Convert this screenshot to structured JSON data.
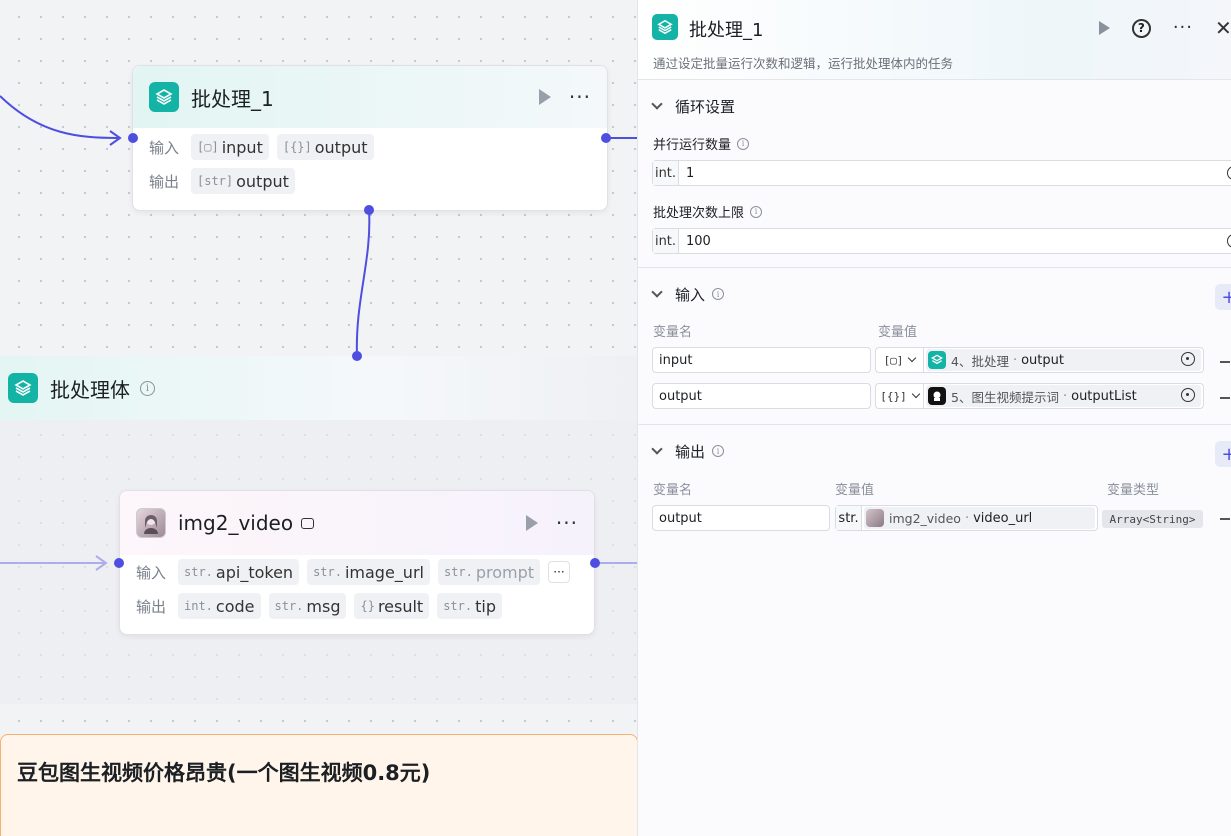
{
  "canvas": {
    "batch_node": {
      "title": "批处理_1",
      "input_label": "输入",
      "output_label": "输出",
      "inputs": [
        {
          "type": "[▢]",
          "name": "input"
        },
        {
          "type": "[{}]",
          "name": "output"
        }
      ],
      "outputs": [
        {
          "type": "[str]",
          "name": "output"
        }
      ]
    },
    "group": {
      "title": "批处理体"
    },
    "video_node": {
      "title": "img2_video",
      "input_label": "输入",
      "output_label": "输出",
      "inputs": [
        {
          "type": "str.",
          "name": "api_token"
        },
        {
          "type": "str.",
          "name": "image_url"
        },
        {
          "type": "str.",
          "name": "prompt"
        }
      ],
      "more": "···",
      "outputs": [
        {
          "type": "int.",
          "name": "code"
        },
        {
          "type": "str.",
          "name": "msg"
        },
        {
          "type": "{}",
          "name": "result"
        },
        {
          "type": "str.",
          "name": "tip"
        }
      ]
    },
    "note": {
      "text": "豆包图生视频价格昂贵(一个图生视频0.8元)"
    }
  },
  "panel": {
    "title": "批处理_1",
    "description": "通过设定批量运行次数和逻辑，运行批处理体内的任务",
    "close": "✕",
    "loop": {
      "header": "循环设置",
      "parallel_label": "并行运行数量",
      "parallel_prefix": "int.",
      "parallel_value": "1",
      "max_label": "批处理次数上限",
      "max_prefix": "int.",
      "max_value": "100"
    },
    "inputs": {
      "header": "输入",
      "col_name": "变量名",
      "col_value": "变量值",
      "add": "+",
      "rows": [
        {
          "name": "input",
          "type": "[▢]",
          "node": "4、批处理",
          "var": "output"
        },
        {
          "name": "output",
          "type": "[{}]",
          "node": "5、图生视频提示词",
          "var": "outputList"
        }
      ]
    },
    "outputs": {
      "header": "输出",
      "col_name": "变量名",
      "col_value": "变量值",
      "col_type": "变量类型",
      "add": "+",
      "rows": [
        {
          "name": "output",
          "prefix": "str.",
          "node": "img2_video",
          "var": "video_url",
          "type": "Array<String>"
        }
      ]
    }
  }
}
